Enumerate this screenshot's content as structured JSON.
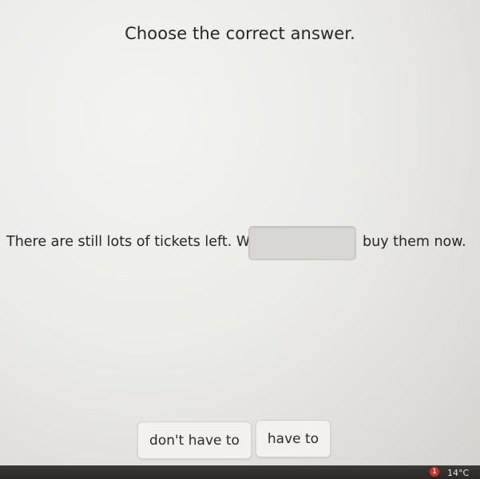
{
  "instruction": "Choose the correct answer.",
  "sentence": {
    "before_blank": "There are still lots of tickets left. We",
    "after_blank": "buy them now."
  },
  "options": [
    {
      "label": "don't have to"
    },
    {
      "label": "have to"
    }
  ],
  "taskbar": {
    "badge_count": "1",
    "temperature": "14°C"
  },
  "colors": {
    "answer_slot": "#d9d7d3",
    "option_background": "#f2f1ef",
    "taskbar": "#2f2e2a"
  }
}
